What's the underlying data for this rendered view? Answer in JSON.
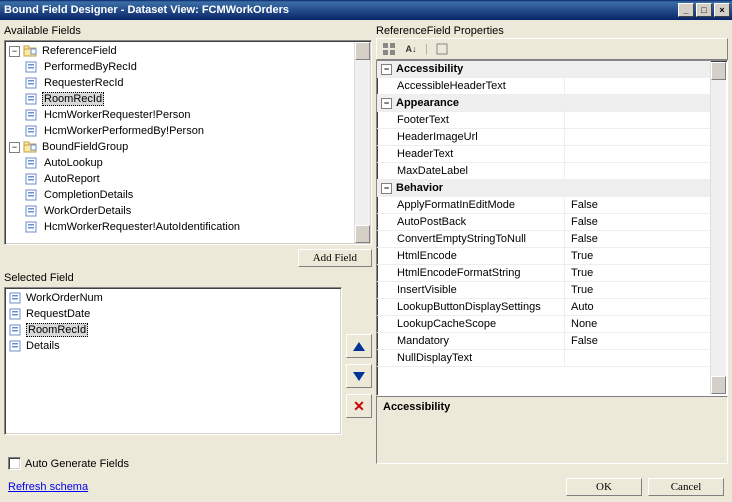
{
  "title": "Bound Field Designer - Dataset View: FCMWorkOrders",
  "window_buttons": {
    "min": "_",
    "max": "□",
    "close": "×"
  },
  "labels": {
    "available": "Available Fields",
    "selected": "Selected Field",
    "props_title": "ReferenceField Properties",
    "add_field": "Add Field",
    "auto_gen": "Auto Generate Fields",
    "refresh": "Refresh schema",
    "ok": "OK",
    "cancel": "Cancel",
    "desc_title": "Accessibility"
  },
  "tree": {
    "nodes": [
      {
        "label": "ReferenceField",
        "level": 0,
        "expanded": true,
        "group": true
      },
      {
        "label": "PerformedByRecId",
        "level": 1
      },
      {
        "label": "RequesterRecId",
        "level": 1
      },
      {
        "label": "RoomRecId",
        "level": 1,
        "selected": true
      },
      {
        "label": "HcmWorkerRequester!Person",
        "level": 1
      },
      {
        "label": "HcmWorkerPerformedBy!Person",
        "level": 1
      },
      {
        "label": "BoundFieldGroup",
        "level": 0,
        "expanded": true,
        "group": true
      },
      {
        "label": "AutoLookup",
        "level": 1
      },
      {
        "label": "AutoReport",
        "level": 1
      },
      {
        "label": "CompletionDetails",
        "level": 1
      },
      {
        "label": "WorkOrderDetails",
        "level": 1
      },
      {
        "label": "HcmWorkerRequester!AutoIdentification",
        "level": 1
      }
    ]
  },
  "selected_list": [
    {
      "label": "WorkOrderNum"
    },
    {
      "label": "RequestDate"
    },
    {
      "label": "RoomRecId",
      "selected": true
    },
    {
      "label": "Details"
    }
  ],
  "properties": {
    "categories": [
      {
        "name": "Accessibility",
        "rows": [
          {
            "name": "AccessibleHeaderText",
            "value": ""
          }
        ]
      },
      {
        "name": "Appearance",
        "rows": [
          {
            "name": "FooterText",
            "value": ""
          },
          {
            "name": "HeaderImageUrl",
            "value": ""
          },
          {
            "name": "HeaderText",
            "value": ""
          },
          {
            "name": "MaxDateLabel",
            "value": ""
          }
        ]
      },
      {
        "name": "Behavior",
        "rows": [
          {
            "name": "ApplyFormatInEditMode",
            "value": "False"
          },
          {
            "name": "AutoPostBack",
            "value": "False"
          },
          {
            "name": "ConvertEmptyStringToNull",
            "value": "False"
          },
          {
            "name": "HtmlEncode",
            "value": "True"
          },
          {
            "name": "HtmlEncodeFormatString",
            "value": "True"
          },
          {
            "name": "InsertVisible",
            "value": "True"
          },
          {
            "name": "LookupButtonDisplaySettings",
            "value": "Auto"
          },
          {
            "name": "LookupCacheScope",
            "value": "None"
          },
          {
            "name": "Mandatory",
            "value": "False"
          },
          {
            "name": "NullDisplayText",
            "value": ""
          }
        ]
      }
    ]
  }
}
